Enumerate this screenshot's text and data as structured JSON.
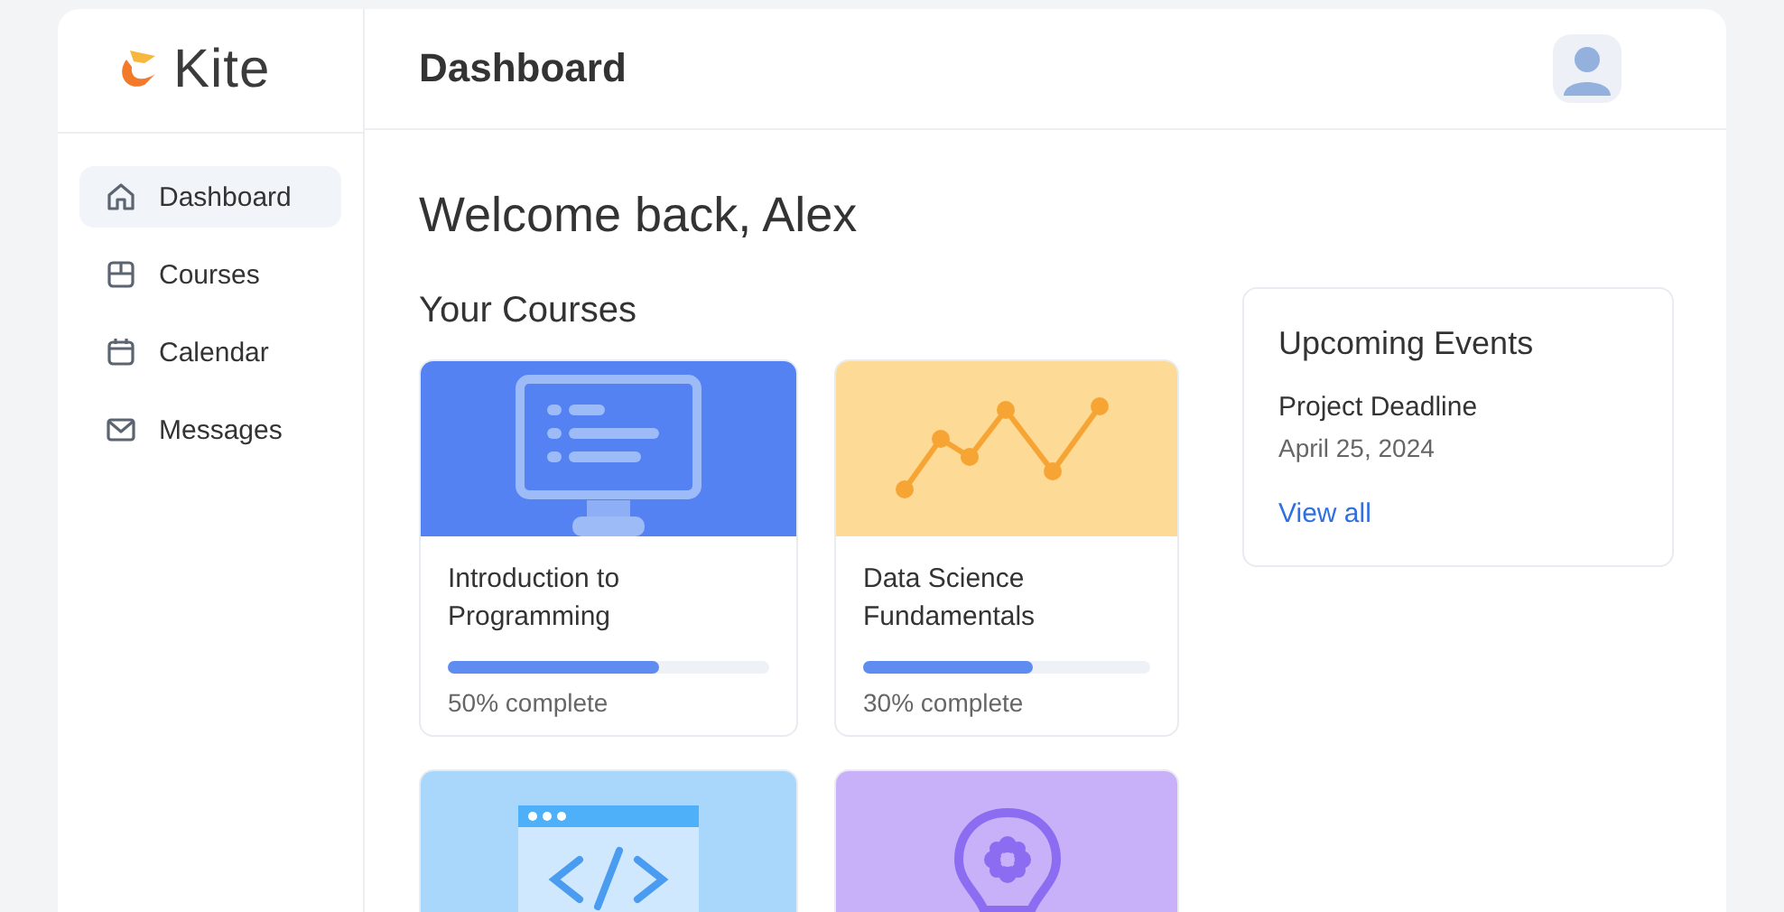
{
  "logo": {
    "text": "Kite"
  },
  "header": {
    "title": "Dashboard"
  },
  "sidebar": {
    "items": [
      {
        "label": "Dashboard",
        "kind": "home",
        "selected": true
      },
      {
        "label": "Courses",
        "kind": "courses",
        "selected": false
      },
      {
        "label": "Calendar",
        "kind": "calendar",
        "selected": false
      },
      {
        "label": "Messages",
        "kind": "mail",
        "selected": false
      }
    ]
  },
  "welcome": "Welcome back, Alex",
  "courses_heading": "Your Courses",
  "courses": [
    {
      "kind": "monitor",
      "color": "#5482f2",
      "title": "Introduction to Programming",
      "level": 0.66,
      "progress": "50% complete"
    },
    {
      "kind": "chart",
      "color": "#fddb96",
      "title": "Data Science Fundamentals",
      "level": 0.59,
      "progress": "30% complete"
    },
    {
      "kind": "code",
      "color": "#a9d7fb"
    },
    {
      "kind": "bulb",
      "color": "#c9b1fa"
    }
  ],
  "events": {
    "title": "Upcoming Events",
    "items": [
      {
        "name": "Project Deadline",
        "date": "April 25, 2024"
      }
    ],
    "link": "View all"
  }
}
